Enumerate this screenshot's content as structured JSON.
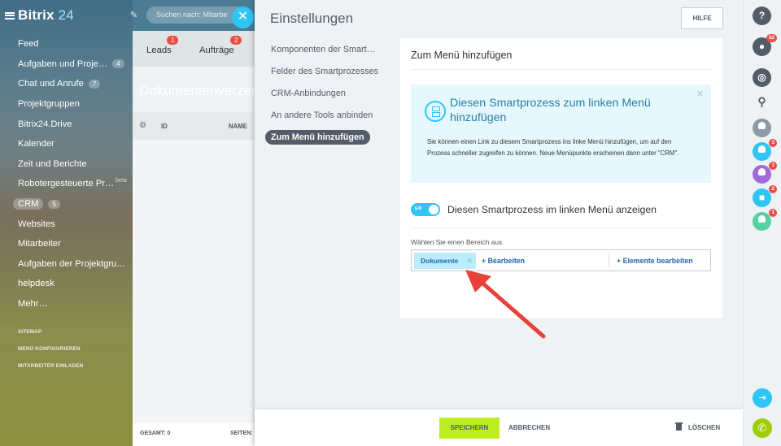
{
  "app": {
    "logo_main": "Bitrix",
    "logo_num": "24"
  },
  "sidebar": {
    "items": [
      {
        "label": "Feed",
        "count": ""
      },
      {
        "label": "Aufgaben und Proje…",
        "count": "4"
      },
      {
        "label": "Chat und Anrufe",
        "count": "7"
      },
      {
        "label": "Projektgruppen",
        "count": ""
      },
      {
        "label": "Bitrix24.Drive",
        "count": ""
      },
      {
        "label": "Kalender",
        "count": ""
      },
      {
        "label": "Zeit und Berichte",
        "count": ""
      },
      {
        "label": "Robotergesteuerte Pr…",
        "count": "",
        "tag": "beta"
      },
      {
        "label": "CRM",
        "count": "5"
      },
      {
        "label": "Websites",
        "count": ""
      },
      {
        "label": "Mitarbeiter",
        "count": ""
      },
      {
        "label": "Aufgaben der Projektgru…",
        "count": ""
      },
      {
        "label": "helpdesk",
        "count": ""
      },
      {
        "label": "Mehr…",
        "count": ""
      }
    ],
    "links": [
      "SITEMAP",
      "MENÜ KONFIGURIEREN",
      "MITARBEITER EINLADEN"
    ]
  },
  "background": {
    "search_placeholder": "Suchen nach: Mitarbe",
    "tabs": [
      {
        "label": "Leads",
        "badge": "1"
      },
      {
        "label": "Aufträge",
        "badge": "2"
      }
    ],
    "title": "Dokumentenverzeic",
    "columns": [
      "ID",
      "NAME"
    ],
    "footer_total": "GESAMT: 0",
    "footer_pages": "SEITEN:"
  },
  "panel": {
    "title": "Einstellungen",
    "help_label": "HILFE",
    "nav": [
      "Komponenten der Smart…",
      "Felder des Smartprozesses",
      "CRM-Anbindungen",
      "An andere Tools anbinden",
      "Zum Menü hinzufügen"
    ],
    "card_title": "Zum Menü hinzufügen",
    "info_title": "Diesen Smartprozess zum linken Menü hinzufügen",
    "info_text": "Sie können einen Link zu diesem Smartprozess ins linke Menü hinzufügen, um auf den Prozess schneller zugreifen zu können. Neue Menüpunkte erscheinen dann unter \"CRM\".",
    "toggle_state": "EIN",
    "toggle_label": "Diesen Smartprozess im linken Menü anzeigen",
    "selector_label": "Wählen Sie einen Bereich aus",
    "chip": "Dokumente",
    "edit_link": "+ Bearbeiten",
    "edit_elements": "+ Elemente bearbeiten",
    "save_label": "SPEICHERN",
    "cancel_label": "ABBRECHEN",
    "delete_label": "LÖSCHEN"
  },
  "rightbar": {
    "badges": {
      "notifications": "32",
      "user1": "3",
      "user2": "1",
      "lock": "2",
      "user3": "1"
    }
  },
  "colors": {
    "accent": "#2fc6f6",
    "save": "#bbed21",
    "badge": "#ee4b44",
    "arrow": "#e8413b"
  }
}
